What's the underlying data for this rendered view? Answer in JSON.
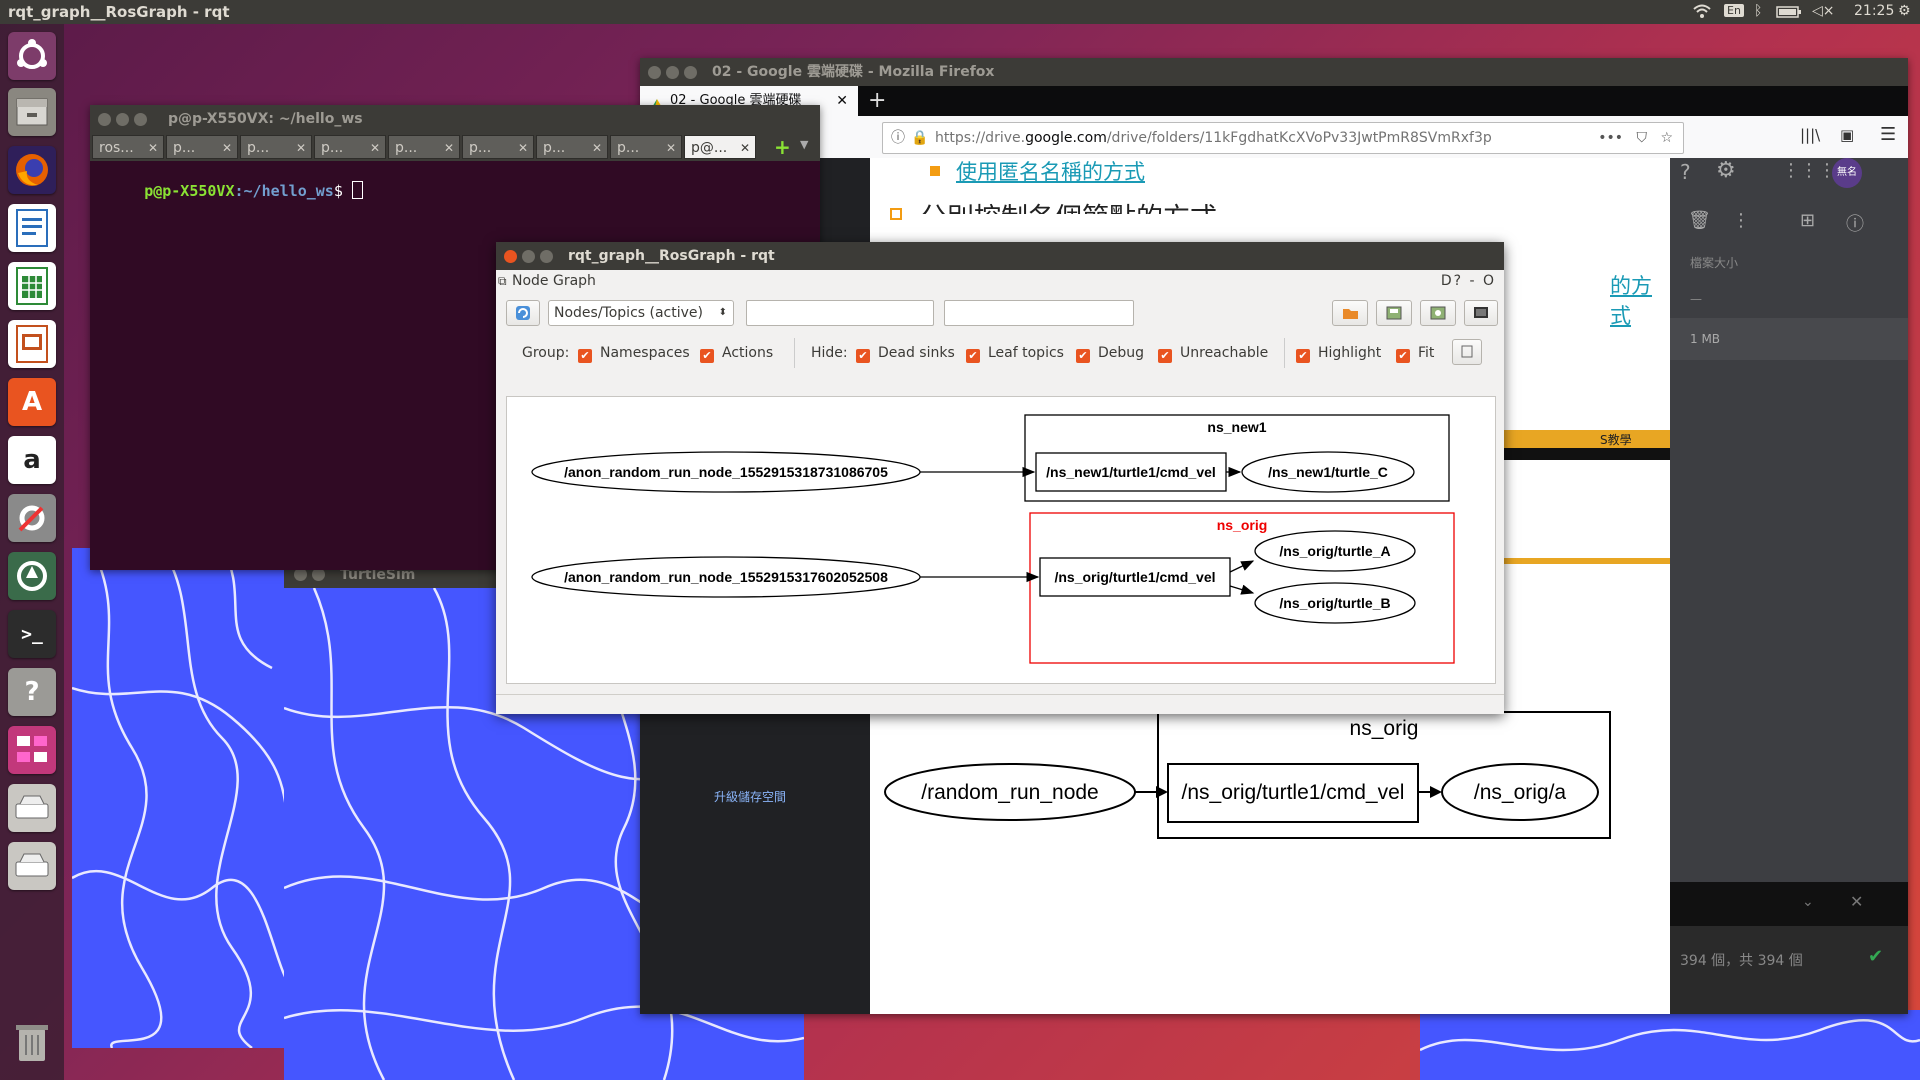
{
  "top_panel": {
    "title": "rqt_graph__RosGraph - rqt",
    "lang": "En",
    "volume": "◁×",
    "time": "21:25"
  },
  "launcher": [
    "ubuntu-dash",
    "files",
    "firefox",
    "writer",
    "calc",
    "impress",
    "software-center",
    "amazon",
    "system-settings",
    "software-updater",
    "terminal",
    "help",
    "rqt",
    "disk-1",
    "disk-2",
    "trash"
  ],
  "firefox": {
    "title": "02 - Google 雲端硬碟 - Mozilla Firefox",
    "tab_label": "02 - Google 雲端硬碟",
    "new_tab": "+",
    "url_prefix": "https://drive.",
    "url_domain": "google.com",
    "url_path": "/drive/folders/11kFgdhatKcXVoPv33JwtPmR8SVmRxf3p",
    "doc": {
      "link1": "使用匿名名稱的方式",
      "heading": "分別控制各個節點的方式",
      "link2": "的方式",
      "banner_text": "S教學",
      "graph": {
        "cluster": "ns_orig",
        "node_a": "/random_run_node",
        "topic": "/ns_orig/turtle1/cmd_vel",
        "node_b": "/ns_orig/a"
      }
    },
    "sidebar": {
      "upgrade": "升級儲存空間",
      "file_size_header": "檔案大小",
      "dash": "—",
      "size": "1 MB",
      "avatar": "無名",
      "upload_status": "394 個，共 394 個"
    }
  },
  "terminal": {
    "title": "p@p-X550VX: ~/hello_ws",
    "tabs": [
      "ros...",
      "p...",
      "p...",
      "p...",
      "p...",
      "p...",
      "p...",
      "p...",
      "p@..."
    ],
    "prompt_user": "p@p-X550VX",
    "prompt_path": ":~/hello_ws",
    "prompt_symbol": "$ "
  },
  "turtlesim": {
    "title": "TurtleSim"
  },
  "rqt": {
    "title": "rqt_graph__RosGraph - rqt",
    "plugin": "Node Graph",
    "header_controls": "D?  - O",
    "mode": "Nodes/Topics (active)",
    "filter1": "",
    "filter2": "",
    "group_label": "Group:",
    "namespaces": "Namespaces",
    "actions": "Actions",
    "hide_label": "Hide:",
    "dead_sinks": "Dead sinks",
    "leaf_topics": "Leaf topics",
    "debug": "Debug",
    "unreachable": "Unreachable",
    "highlight": "Highlight",
    "fit": "Fit",
    "graph": {
      "cluster1": "ns_new1",
      "cluster2": "ns_orig",
      "anon1": "/anon_random_run_node_1552915318731086705",
      "anon2": "/anon_random_run_node_1552915317602052508",
      "topic1": "/ns_new1/turtle1/cmd_vel",
      "topic2": "/ns_orig/turtle1/cmd_vel",
      "turtle_c": "/ns_new1/turtle_C",
      "turtle_a": "/ns_orig/turtle_A",
      "turtle_b": "/ns_orig/turtle_B"
    }
  },
  "colors": {
    "panel": "#3c3b37",
    "accent": "#e95420",
    "turtle_bg": "#4556ff",
    "terminal_bg": "#300a24",
    "doc_banner": "#e8a623"
  }
}
